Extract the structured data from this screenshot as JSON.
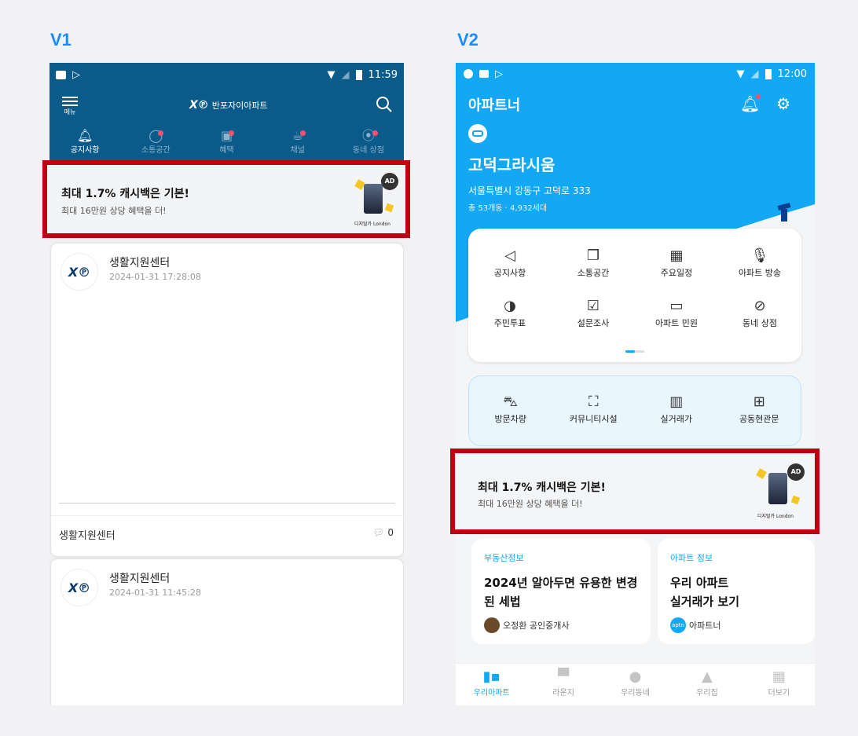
{
  "labels": {
    "v1": "V1",
    "v2": "V2"
  },
  "v1": {
    "status": {
      "time": "11:59"
    },
    "header": {
      "menu_label": "메뉴",
      "logo": "반포자이아파트"
    },
    "tabs": [
      {
        "label": "공지사항"
      },
      {
        "label": "소통공간"
      },
      {
        "label": "혜택"
      },
      {
        "label": "채널"
      },
      {
        "label": "동네 상점"
      }
    ],
    "ad": {
      "title": "최대 1.7% 캐시백은 기본!",
      "subtitle": "최대 16만원 상당 혜택을 더!",
      "badge": "AD",
      "card_brand": "디지털카 London"
    },
    "posts": [
      {
        "author": "생활지원센터",
        "date": "2024-01-31 17:28:08",
        "footer": "생활지원센터",
        "comments": "0"
      },
      {
        "author": "생활지원센터",
        "date": "2024-01-31 11:45:28"
      }
    ]
  },
  "v2": {
    "status": {
      "time": "12:00"
    },
    "app_title": "아파트너",
    "complex": {
      "name": "고덕그라시움",
      "address": "서울특별시 강동구 고덕로 333",
      "meta": "총 53개동 · 4,932세대"
    },
    "menu_items": [
      {
        "label": "공지사항",
        "icon": "megaphone-icon"
      },
      {
        "label": "소통공간",
        "icon": "chat-icon"
      },
      {
        "label": "주요일정",
        "icon": "calendar-icon"
      },
      {
        "label": "아파트 방송",
        "icon": "mic-icon"
      },
      {
        "label": "주민투표",
        "icon": "vote-icon"
      },
      {
        "label": "설문조사",
        "icon": "survey-icon"
      },
      {
        "label": "아파트 민원",
        "icon": "complaint-icon"
      },
      {
        "label": "동네 상점",
        "icon": "discount-icon"
      }
    ],
    "service_items": [
      {
        "label": "방문차량",
        "icon": "car-icon"
      },
      {
        "label": "커뮤니티시설",
        "icon": "scan-icon"
      },
      {
        "label": "실거래가",
        "icon": "building-icon"
      },
      {
        "label": "공동현관문",
        "icon": "door-icon"
      }
    ],
    "ad": {
      "title": "최대 1.7% 캐시백은 기본!",
      "subtitle": "최대 16만원 상당 혜택을 더!",
      "badge": "AD",
      "card_brand": "디지털카 London"
    },
    "info_cards": [
      {
        "category": "부동산정보",
        "title_line1": "2024년 알아두면 유용한 변경",
        "title_line2": "된 세법",
        "author": "오정환 공인중개사"
      },
      {
        "category": "아파트 정보",
        "title_line1": "우리 아파트",
        "title_line2": "실거래가 보기",
        "author": "아파트너",
        "author_badge": "aptn"
      }
    ],
    "bottom_nav": [
      {
        "label": "우리아파트"
      },
      {
        "label": "라운지"
      },
      {
        "label": "우리동네"
      },
      {
        "label": "우리집"
      },
      {
        "label": "더보기"
      }
    ]
  },
  "colors": {
    "v1_header": "#0a5b8a",
    "v2_blue": "#12a8f4",
    "highlight": "#c00012",
    "badge_dot": "#ff4f6d"
  }
}
